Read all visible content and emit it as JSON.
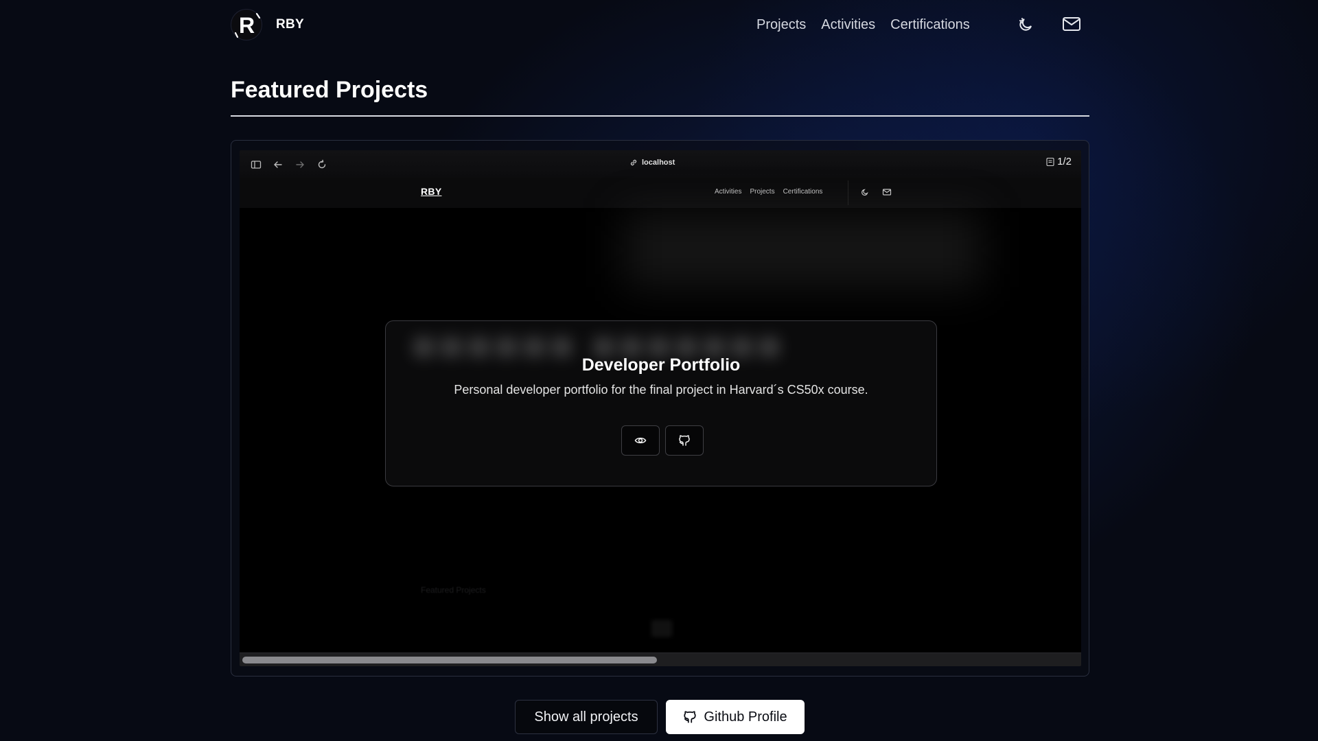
{
  "header": {
    "brand_initial": "R",
    "brand_name": "RBY",
    "nav": [
      "Projects",
      "Activities",
      "Certifications"
    ],
    "icons": [
      "theme-toggle-icon",
      "mail-icon"
    ]
  },
  "section": {
    "title": "Featured Projects"
  },
  "preview": {
    "toolbar_icons": [
      "sidebar-icon",
      "back-arrow-icon",
      "forward-arrow-icon",
      "reload-icon"
    ],
    "url": "localhost",
    "counter": "1/2",
    "inner_brand": "RBY",
    "inner_nav": [
      "Activities",
      "Projects",
      "Certifications"
    ],
    "inner_section": "Featured Projects",
    "scroll_position": 0.49
  },
  "project": {
    "title": "Developer Portfolio",
    "description": "Personal developer portfolio for the final project in Harvard´s CS50x course.",
    "actions": [
      "eye-icon",
      "github-icon"
    ]
  },
  "buttons": {
    "show_all": "Show all projects",
    "github_profile": "Github Profile"
  },
  "colors": {
    "background": "#070a14",
    "accent_glow": "#12286e",
    "primary_button": "#ffffff"
  }
}
